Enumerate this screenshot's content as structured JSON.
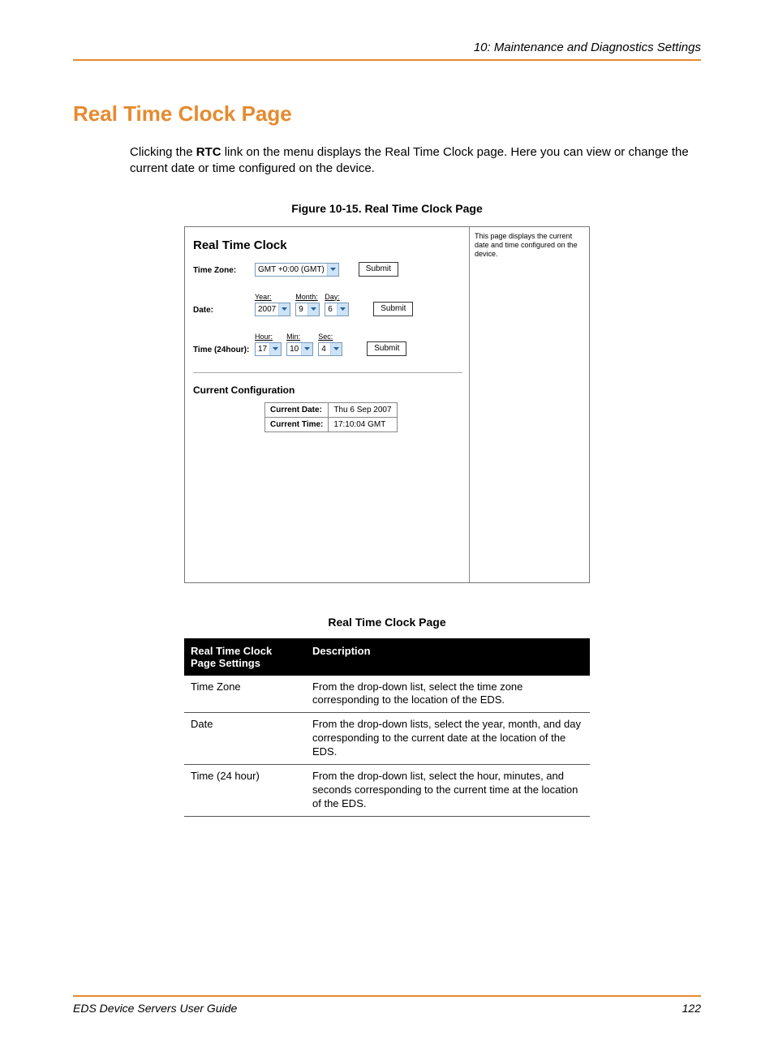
{
  "header": {
    "section": "10: Maintenance and Diagnostics Settings"
  },
  "title": "Real Time Clock Page",
  "intro": {
    "pre": "Clicking the ",
    "bold": "RTC",
    "post": " link on the menu displays the Real Time Clock page. Here you can view or change the current date or time configured on the device."
  },
  "figure": {
    "caption": "Figure 10-15. Real Time Clock Page",
    "panel_title": "Real Time Clock",
    "sidebar_text": "This page displays the current date and time configured on the device.",
    "timezone": {
      "label": "Time Zone:",
      "value": "GMT +0:00 (GMT)",
      "submit": "Submit"
    },
    "date": {
      "label": "Date:",
      "year_hdr": "Year:",
      "year": "2007",
      "month_hdr": "Month:",
      "month": "9",
      "day_hdr": "Day:",
      "day": "6",
      "submit": "Submit"
    },
    "time": {
      "label": "Time (24hour):",
      "hour_hdr": "Hour:",
      "hour": "17",
      "min_hdr": "Min:",
      "min": "10",
      "sec_hdr": "Sec:",
      "sec": "4",
      "submit": "Submit"
    },
    "current": {
      "title": "Current Configuration",
      "date_label": "Current Date:",
      "date_value": "Thu 6 Sep 2007",
      "time_label": "Current Time:",
      "time_value": "17:10:04 GMT"
    }
  },
  "desc_table": {
    "caption": "Real Time Clock Page",
    "headers": {
      "col1": "Real Time Clock Page Settings",
      "col2": "Description"
    },
    "rows": [
      {
        "k": "Time Zone",
        "v": "From the drop-down list, select the time zone corresponding to the location of the EDS."
      },
      {
        "k": "Date",
        "v": "From the drop-down lists, select the year, month, and day corresponding to the current date at the location of the EDS."
      },
      {
        "k": "Time (24 hour)",
        "v": "From the drop-down list, select the hour, minutes, and seconds corresponding to the current time at the location of the EDS."
      }
    ]
  },
  "footer": {
    "left": "EDS Device Servers User Guide",
    "right": "122"
  }
}
